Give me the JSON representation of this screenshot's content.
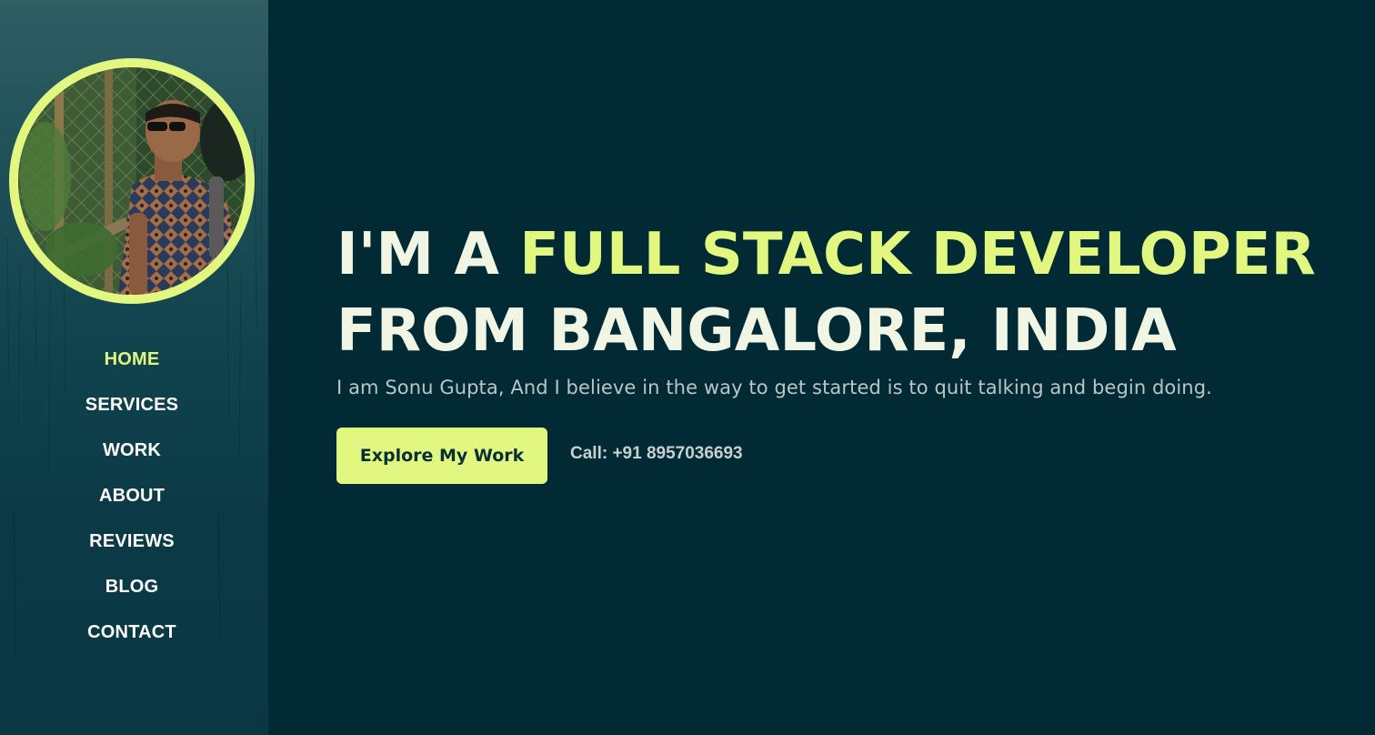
{
  "sidebar": {
    "avatar_alt": "profile-photo",
    "nav": [
      {
        "label": "HOME",
        "active": true
      },
      {
        "label": "SERVICES",
        "active": false
      },
      {
        "label": "WORK",
        "active": false
      },
      {
        "label": "ABOUT",
        "active": false
      },
      {
        "label": "REVIEWS",
        "active": false
      },
      {
        "label": "BLOG",
        "active": false
      },
      {
        "label": "CONTACT",
        "active": false
      }
    ]
  },
  "hero": {
    "headline_prefix": "I'M A ",
    "headline_accent": "FULL STACK DEVELOPER",
    "headline_line2": "FROM BANGALORE, INDIA",
    "tagline": "I am Sonu Gupta, And I believe in the way to get started is to quit talking and begin doing.",
    "cta_label": "Explore My Work",
    "call_text": "Call: +91 8957036693"
  },
  "colors": {
    "background": "#022a34",
    "accent": "#e2f77f",
    "headline": "#f1f5e3",
    "tagline": "#b9c6c8"
  }
}
